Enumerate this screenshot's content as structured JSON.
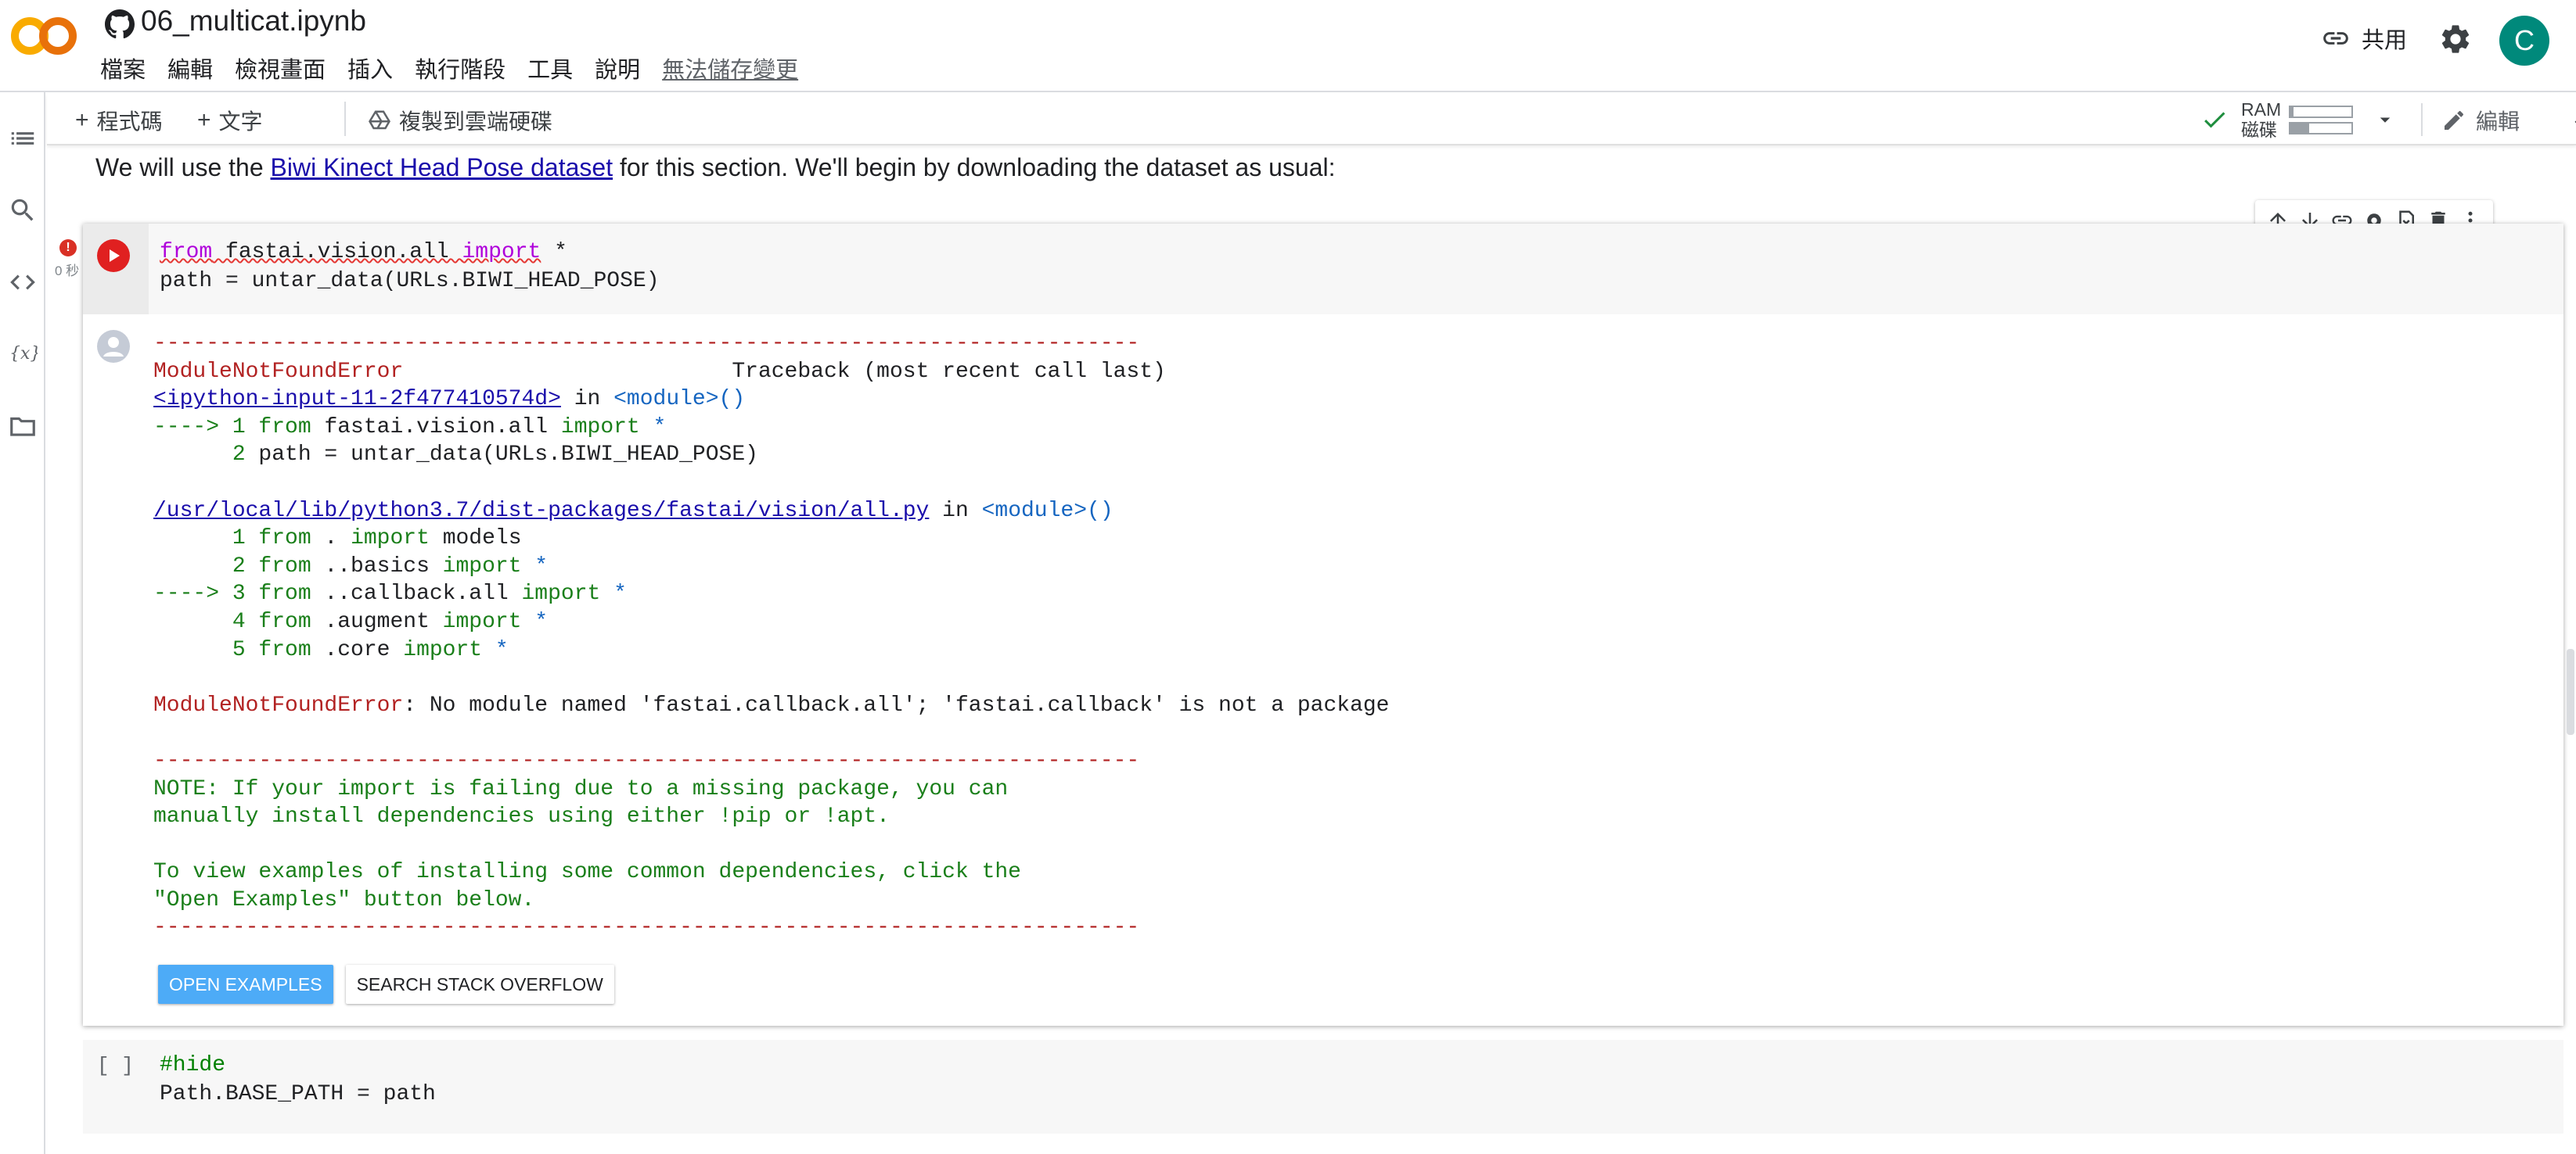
{
  "header": {
    "notebook_title": "06_multicat.ipynb",
    "menu": [
      "檔案",
      "編輯",
      "檢視畫面",
      "插入",
      "執行階段",
      "工具",
      "說明"
    ],
    "unsaved_label": "無法儲存變更",
    "share_label": "共用",
    "avatar_letter": "C"
  },
  "toolbar": {
    "add_code_label": "程式碼",
    "add_text_label": "文字",
    "copy_drive_label": "複製到雲端硬碟",
    "ram_label": "RAM",
    "disk_label": "磁碟",
    "ram_fraction": 0.05,
    "disk_fraction": 0.3,
    "edit_label": "編輯"
  },
  "text_cell": {
    "before": "We will use the ",
    "link": "Biwi Kinect Head Pose dataset",
    "after": " for this section. We'll begin by downloading the dataset as usual:"
  },
  "code_cell": {
    "exec_time": "0 秒",
    "line1_kw1": "from",
    "line1_mod": " fastai.vision.all ",
    "line1_kw2": "import",
    "line1_rest": " *",
    "line2": "path = untar_data(URLs.BIWI_HEAD_POSE)"
  },
  "output": {
    "dash_line": "---------------------------------------------------------------------------",
    "err_name": "ModuleNotFoundError",
    "traceback_header": "                         Traceback (most recent call last)",
    "input_link": "<ipython-input-11-2f477410574d>",
    "in_word": " in ",
    "module_word": "<module>",
    "parens": "()",
    "arrow1": "----> 1 ",
    "t1_from": "from",
    "t1_mod": " fastai.vision.all ",
    "t1_import": "import",
    "t1_star": " *",
    "t2_num": "      2 ",
    "t2_code": "path = untar_data(URLs.BIWI_HEAD_POSE)",
    "file_link": "/usr/local/lib/python3.7/dist-packages/fastai/vision/all.py",
    "l1_num": "      1 ",
    "l1_mod": " . ",
    "l1_rest": " models",
    "l2_num": "      2 ",
    "l2_mod": " ..basics ",
    "l3_num": "----> 3 ",
    "l3_mod": " ..callback.all ",
    "l4_num": "      4 ",
    "l4_mod": " .augment ",
    "l5_num": "      5 ",
    "l5_mod": " .core ",
    "star": " *",
    "final_err_name": "ModuleNotFoundError",
    "final_err_msg": ": No module named 'fastai.callback.all'; 'fastai.callback' is not a package",
    "note1": "NOTE: If your import is failing due to a missing package, you can",
    "note2": "manually install dependencies using either !pip or !apt.",
    "note3": "To view examples of installing some common dependencies, click the",
    "note4": "\"Open Examples\" button below.",
    "open_examples": "OPEN EXAMPLES",
    "search_so": "SEARCH STACK OVERFLOW"
  },
  "cell2": {
    "bracket": "[ ]",
    "line1": "#hide",
    "line2": "Path.BASE_PATH = path"
  }
}
